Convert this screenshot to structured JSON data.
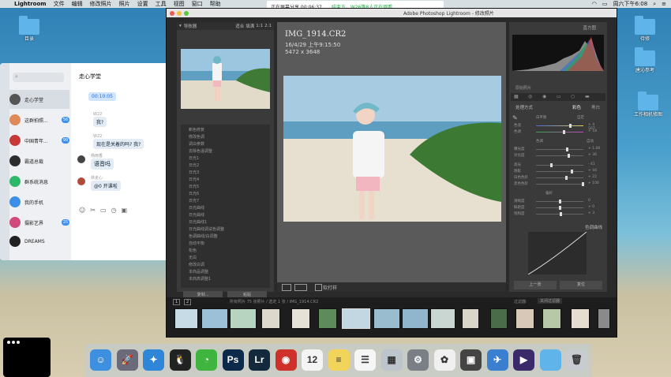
{
  "menubar": {
    "apple": "",
    "app": "Lightroom",
    "items": [
      "文件",
      "编辑",
      "修改照片",
      "照片",
      "设置",
      "工具",
      "视图",
      "窗口",
      "帮助"
    ],
    "clock": "周六下午6:08"
  },
  "recording": {
    "label": "正在屏幕分享 00:06:37",
    "extra": "结束五，W26等8人正在观看"
  },
  "desktop": {
    "left_folder": "目录",
    "right_folders": [
      "待修",
      "唐沁参考",
      "工作相机修图"
    ]
  },
  "chat": {
    "user_title": "走心学堂",
    "contacts": [
      {
        "name": "走心学堂",
        "badge": ""
      },
      {
        "name": "这群拍照...",
        "badge": "56"
      },
      {
        "name": "中国青年...",
        "badge": "99"
      },
      {
        "name": "霸道总裁",
        "badge": ""
      },
      {
        "name": "群系统消息",
        "badge": ""
      },
      {
        "name": "我的手机",
        "badge": ""
      },
      {
        "name": "摄影艺界",
        "badge": "25"
      },
      {
        "name": "DREAMS",
        "badge": ""
      }
    ],
    "messages": [
      {
        "sender": "",
        "text": "00:10:05"
      },
      {
        "sender": "W22",
        "text": "我?"
      },
      {
        "sender": "W22",
        "text": "现在是关着的吗? 我?"
      },
      {
        "sender": "杨雨香",
        "text": "语音吗"
      },
      {
        "sender": "林走心",
        "text": "@0 开课啦"
      }
    ]
  },
  "lightroom": {
    "window_title": "Adobe Photoshop Lightroom - 修改照片",
    "navigator": {
      "title": "导航器",
      "zoom": [
        "适合",
        "填满",
        "1:1",
        "2:1"
      ]
    },
    "history": [
      "断色修复",
      "修改色调",
      "调白参数",
      "去除色温调整",
      "日光1",
      "日光2",
      "日光3",
      "日光4",
      "日光5",
      "日光6",
      "日光7",
      "日光曲线",
      "日光曲线",
      "日光曲线1",
      "日光曲线调试色调整",
      "色调曲线/白调整",
      "自动平衡",
      "松色",
      "无白",
      "修改白调",
      "本商品调整",
      "本商高调整1"
    ],
    "left_buttons": [
      "复制...",
      "粘贴"
    ],
    "photo": {
      "filename": "IMG_1914.CR2",
      "date": "16/4/29 上午9:15:50",
      "size": "5472 x 3648"
    },
    "toolbar_label": "软打样",
    "right": {
      "histogram_title": "直方图",
      "original_label": "原始照片",
      "basic_title": "基本",
      "panel_labels": [
        "处理方式",
        "彩色",
        "黑白"
      ],
      "sliders": [
        {
          "label": "白平衡",
          "value": "自定"
        },
        {
          "label": "色温",
          "value": "+ 4 507"
        },
        {
          "label": "色调",
          "value": "+ 18"
        },
        {
          "label": "色调",
          "value": "自动"
        },
        {
          "label": "曝光度",
          "value": "+ 1.06"
        },
        {
          "label": "对比度",
          "value": "+ 36"
        },
        {
          "label": "高光",
          "value": "- 41"
        },
        {
          "label": "阴影",
          "value": "+ 44"
        },
        {
          "label": "白色色阶",
          "value": "+ 22"
        },
        {
          "label": "黑色色阶",
          "value": "+ 100"
        },
        {
          "label": "偏好",
          "value": ""
        },
        {
          "label": "清晰度",
          "value": "0"
        },
        {
          "label": "鲜艳度",
          "value": "+ 0"
        },
        {
          "label": "饱和度",
          "value": "+ 3"
        }
      ],
      "curve_title": "色调曲线",
      "bottom_buttons": [
        "上一张",
        "复位"
      ]
    },
    "filmstrip": {
      "pages": [
        "1",
        "2"
      ],
      "path": "所有照片  75 张照片 / 选定 1 张 / IMG_1914.CR2",
      "filter_label": "过滤器:",
      "filter_value": "关闭过滤器"
    }
  },
  "dock": [
    {
      "name": "finder",
      "glyph": "☺",
      "color": "#3e8fe0"
    },
    {
      "name": "launchpad",
      "glyph": "🚀",
      "color": "#6a6a7a"
    },
    {
      "name": "safari",
      "glyph": "✦",
      "color": "#2e86d8"
    },
    {
      "name": "qq",
      "glyph": "🐧",
      "color": "#222"
    },
    {
      "name": "wechat",
      "glyph": "◔",
      "color": "#3fb53f"
    },
    {
      "name": "photoshop",
      "glyph": "Ps",
      "color": "#0e2a4a"
    },
    {
      "name": "lightroom",
      "glyph": "Lr",
      "color": "#132a3d"
    },
    {
      "name": "netease-music",
      "glyph": "◉",
      "color": "#d0302a"
    },
    {
      "name": "calendar",
      "glyph": "12",
      "color": "#f4f4f4"
    },
    {
      "name": "notes",
      "glyph": "≡",
      "color": "#f2d45a"
    },
    {
      "name": "reminders",
      "glyph": "☰",
      "color": "#f6f6f6"
    },
    {
      "name": "preview",
      "glyph": "▦",
      "color": "#bdc5cc"
    },
    {
      "name": "system-preferences",
      "glyph": "⚙",
      "color": "#7a7f86"
    },
    {
      "name": "photos",
      "glyph": "✿",
      "color": "#f0f0f0"
    },
    {
      "name": "photo-booth",
      "glyph": "▣",
      "color": "#444"
    },
    {
      "name": "airmail",
      "glyph": "✈",
      "color": "#3a7fd0"
    },
    {
      "name": "infuse",
      "glyph": "▶",
      "color": "#3b2a6a"
    },
    {
      "name": "downloads-folder",
      "glyph": "",
      "color": "#5fb4ea"
    },
    {
      "name": "trash",
      "glyph": "🗑",
      "color": "#c8cbd0"
    }
  ]
}
